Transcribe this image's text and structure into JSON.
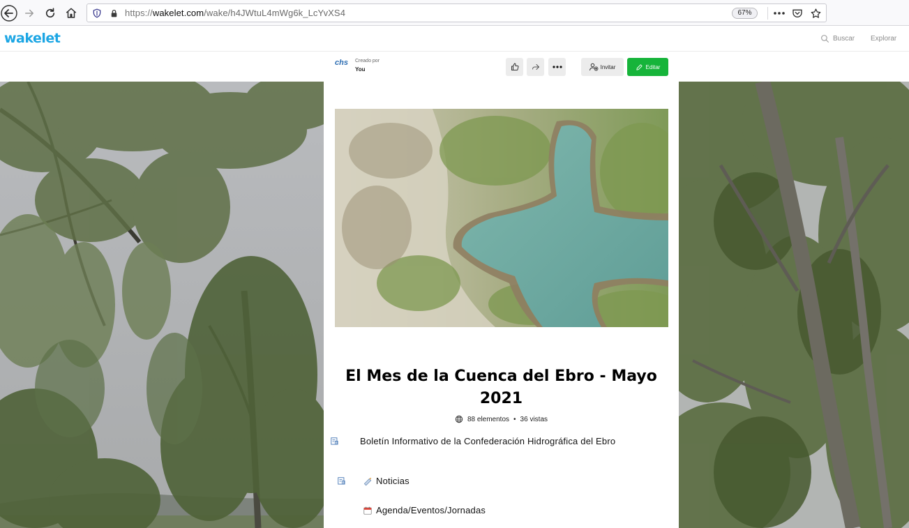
{
  "browser": {
    "url_scheme": "https://",
    "url_host": "wakelet.com",
    "url_path": "/wake/h4JWtuL4mWg6k_LcYvXS4",
    "zoom": "67%"
  },
  "header": {
    "logo": "wakelet",
    "search_label": "Buscar",
    "explore_label": "Explorar"
  },
  "toolbar": {
    "creator_logo": "chs",
    "created_by_label": "Creado por",
    "creator_name": "You",
    "invite_label": "Invitar",
    "edit_label": "Editar"
  },
  "collection": {
    "title": "El Mes de la Cuenca del Ebro - Mayo 2021",
    "items_count": "88 elementos",
    "separator": "•",
    "views": "36 vistas",
    "items": [
      {
        "text": "Boletín Informativo de la Confederación Hidrográfica del Ebro"
      },
      {
        "text": "Noticias"
      },
      {
        "text": "Agenda/Eventos/Jornadas"
      }
    ]
  },
  "colors": {
    "brand": "#1ca6e4",
    "edit_green": "#16b43a"
  }
}
